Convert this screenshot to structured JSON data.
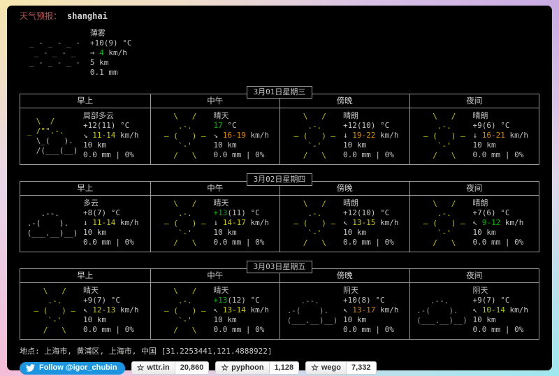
{
  "header": {
    "label": "天气预报：",
    "location": "shanghai"
  },
  "units": {
    "wind": "km/h"
  },
  "colors": {
    "default": "#c4c4c4",
    "green": "#00b400",
    "yellowgreen": "#9ed000",
    "yellow": "#c9c900",
    "orange": "#d78700",
    "gray": "#9a9a9a",
    "white": "#c4c4c4"
  },
  "icons": {
    "mist": {
      "lines": [
        {
          "t": "",
          "c": "gray"
        },
        {
          "t": "_ - _ - _ -",
          "c": "gray"
        },
        {
          "t": " _ - _ - _",
          "c": "gray"
        },
        {
          "t": "_ - _ - _ -",
          "c": "gray"
        }
      ]
    },
    "sunny": {
      "lines": [
        {
          "t": "   \\   /",
          "c": "yellow"
        },
        {
          "t": "    .-.",
          "c": "yellow"
        },
        {
          "t": " ― (   ) ―",
          "c": "yellow"
        },
        {
          "t": "    `-'",
          "c": "yellow"
        },
        {
          "t": "   /   \\",
          "c": "yellow"
        }
      ]
    },
    "partly": {
      "lines": [
        {
          "t": "  \\  /",
          "c": "yellow"
        },
        {
          "t": "_ /\"\".-.",
          "c": "yellow"
        },
        {
          "t": "  \\_(   ).",
          "c": "white"
        },
        {
          "t": "  /(___(__)",
          "c": "white"
        }
      ]
    },
    "cloudy": {
      "lines": [
        {
          "t": "   .--.",
          "c": "white"
        },
        {
          "t": ".-(    ).",
          "c": "white"
        },
        {
          "t": "(___.__)__)",
          "c": "white"
        }
      ]
    },
    "overcast": {
      "lines": [
        {
          "t": "   .--.",
          "c": "gray"
        },
        {
          "t": ".-(    ).",
          "c": "gray"
        },
        {
          "t": "(___.__)__)",
          "c": "gray"
        }
      ]
    }
  },
  "current": {
    "icon": "mist",
    "cond": "薄雾",
    "temp": "+10(9) °C",
    "wind_arrow": "→",
    "wind_value": "4",
    "wind_color": "green",
    "vis": "5 km",
    "precip": "0.1 mm"
  },
  "periods": [
    "早上",
    "中午",
    "傍晚",
    "夜间"
  ],
  "days": [
    {
      "date": "3月01日星期三",
      "cells": [
        {
          "icon": "partly",
          "cond": "局部多云",
          "temp_hl": "",
          "temp_rest": "+12(11) °C",
          "temp_color": "default",
          "wind_arrow": "↘",
          "wind_range": "11-14",
          "wind_color": "yellow",
          "vis": "10 km",
          "precip": "0.0 mm | 0%"
        },
        {
          "icon": "sunny",
          "cond": "晴天",
          "temp_hl": "17",
          "temp_rest": " °C",
          "temp_color": "green",
          "wind_arrow": "↘",
          "wind_range": "16-19",
          "wind_color": "orange",
          "vis": "10 km",
          "precip": "0.0 mm | 0%"
        },
        {
          "icon": "sunny",
          "cond": "晴朗",
          "temp_hl": "",
          "temp_rest": "+12(10) °C",
          "temp_color": "default",
          "wind_arrow": "↓",
          "wind_range": "19-22",
          "wind_color": "orange",
          "vis": "10 km",
          "precip": "0.0 mm | 0%"
        },
        {
          "icon": "sunny",
          "cond": "晴朗",
          "temp_hl": "",
          "temp_rest": "+9(6) °C",
          "temp_color": "default",
          "wind_arrow": "↓",
          "wind_range": "16-21",
          "wind_color": "orange",
          "vis": "10 km",
          "precip": "0.0 mm | 0%"
        }
      ]
    },
    {
      "date": "3月02日星期四",
      "cells": [
        {
          "icon": "cloudy",
          "cond": "多云",
          "temp_hl": "",
          "temp_rest": "+8(7) °C",
          "temp_color": "default",
          "wind_arrow": "↓",
          "wind_range": "11-14",
          "wind_color": "yellow",
          "vis": "10 km",
          "precip": "0.0 mm | 0%"
        },
        {
          "icon": "sunny",
          "cond": "晴天",
          "temp_hl": "+13",
          "temp_rest": "(11) °C",
          "temp_color": "green",
          "wind_arrow": "↓",
          "wind_range": "14-17",
          "wind_color": "yellow",
          "vis": "10 km",
          "precip": "0.0 mm | 0%"
        },
        {
          "icon": "sunny",
          "cond": "晴朗",
          "temp_hl": "",
          "temp_rest": "+12(10) °C",
          "temp_color": "default",
          "wind_arrow": "↖",
          "wind_range": "13-15",
          "wind_color": "yellow",
          "vis": "10 km",
          "precip": "0.0 mm | 0%"
        },
        {
          "icon": "sunny",
          "cond": "晴朗",
          "temp_hl": "",
          "temp_rest": "+7(6) °C",
          "temp_color": "default",
          "wind_arrow": "↖",
          "wind_range": "9-12",
          "wind_color": "green",
          "vis": "10 km",
          "precip": "0.0 mm | 0%"
        }
      ]
    },
    {
      "date": "3月03日星期五",
      "cells": [
        {
          "icon": "sunny",
          "cond": "晴天",
          "temp_hl": "",
          "temp_rest": "+9(7) °C",
          "temp_color": "default",
          "wind_arrow": "↖",
          "wind_range": "12-13",
          "wind_color": "yellow",
          "vis": "10 km",
          "precip": "0.0 mm | 0%"
        },
        {
          "icon": "sunny",
          "cond": "晴天",
          "temp_hl": "+13",
          "temp_rest": "(12) °C",
          "temp_color": "green",
          "wind_arrow": "↖",
          "wind_range": "13-14",
          "wind_color": "yellow",
          "vis": "10 km",
          "precip": "0.0 mm | 0%"
        },
        {
          "icon": "overcast",
          "cond": "阴天",
          "temp_hl": "",
          "temp_rest": "+10(8) °C",
          "temp_color": "default",
          "wind_arrow": "↖",
          "wind_range": "13-17",
          "wind_color": "orange",
          "vis": "10 km",
          "precip": "0.0 mm | 0%"
        },
        {
          "icon": "overcast",
          "cond": "阴天",
          "temp_hl": "",
          "temp_rest": "+9(7) °C",
          "temp_color": "default",
          "wind_arrow": "↖",
          "wind_range": "10-14",
          "wind_color": "yellowgreen",
          "vis": "10 km",
          "precip": "0.0 mm | 0%"
        }
      ]
    }
  ],
  "footer": {
    "location_line": "地点: 上海市, 黄浦区, 上海市, 中国 [31.2253441,121.4888922]"
  },
  "badges": {
    "twitter": {
      "label": "Follow @igor_chubin"
    },
    "stars": [
      {
        "name": "wttr.in",
        "count": "20,860"
      },
      {
        "name": "pyphoon",
        "count": "1,128"
      },
      {
        "name": "wego",
        "count": "7,332"
      }
    ]
  }
}
